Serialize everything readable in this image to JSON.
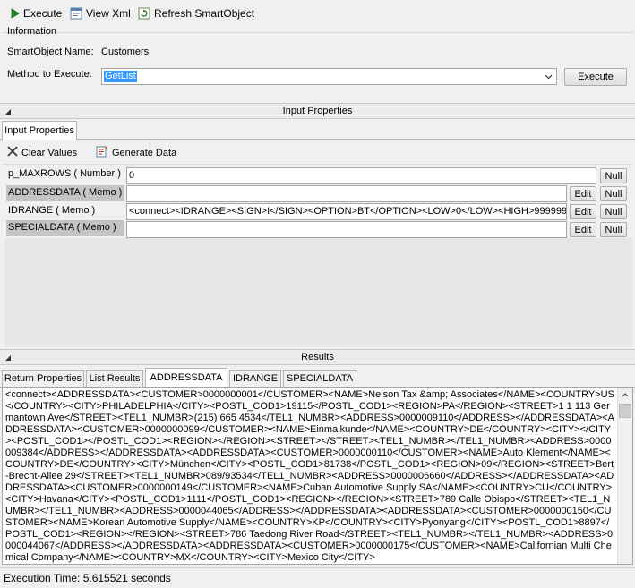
{
  "toolbar": {
    "execute_label": "Execute",
    "view_xml_label": "View Xml",
    "refresh_label": "Refresh SmartObject"
  },
  "information": {
    "group_title": "Information",
    "smartobject_name_label": "SmartObject Name:",
    "smartobject_name_value": "Customers",
    "method_label": "Method to Execute:",
    "method_value": "GetList",
    "execute_button": "Execute"
  },
  "input_properties": {
    "section_title": "Input Properties",
    "tab_label": "Input Properties",
    "clear_values_label": "Clear Values",
    "generate_data_label": "Generate Data",
    "edit_label": "Edit",
    "null_label": "Null",
    "rows": [
      {
        "label": "p_MAXROWS ( Number )",
        "value": "0"
      },
      {
        "label": "ADDRESSDATA ( Memo )",
        "value": ""
      },
      {
        "label": "IDRANGE ( Memo )",
        "value": "<connect><IDRANGE><SIGN>I</SIGN><OPTION>BT</OPTION><LOW>0</LOW><HIGH>9999999"
      },
      {
        "label": "SPECIALDATA ( Memo )",
        "value": ""
      }
    ]
  },
  "results": {
    "section_title": "Results",
    "tabs": [
      "Return Properties",
      "List Results",
      "ADDRESSDATA",
      "IDRANGE",
      "SPECIALDATA"
    ],
    "active_tab": "ADDRESSDATA",
    "text": "<connect><ADDRESSDATA><CUSTOMER>0000000001</CUSTOMER><NAME>Nelson Tax &amp; Associates</NAME><COUNTRY>US</COUNTRY><CITY>PHILADELPHIA</CITY><POSTL_COD1>19115</POSTL_COD1><REGION>PA</REGION><STREET>1 1 113 Germantown Ave</STREET><TEL1_NUMBR>(215) 665 4534</TEL1_NUMBR><ADDRESS>0000009110</ADDRESS></ADDRESSDATA><ADDRESSDATA><CUSTOMER>0000000099</CUSTOMER><NAME>Einmalkunde</NAME><COUNTRY>DE</COUNTRY><CITY></CITY><POSTL_COD1></POSTL_COD1><REGION></REGION><STREET></STREET><TEL1_NUMBR></TEL1_NUMBR><ADDRESS>0000009384</ADDRESS></ADDRESSDATA><ADDRESSDATA><CUSTOMER>0000000110</CUSTOMER><NAME>Auto Klement</NAME><COUNTRY>DE</COUNTRY><CITY>München</CITY><POSTL_COD1>81738</POSTL_COD1><REGION>09</REGION><STREET>Bert-Brecht-Allee 29</STREET><TEL1_NUMBR>089/93534</TEL1_NUMBR><ADDRESS>0000006660</ADDRESS></ADDRESSDATA><ADDRESSDATA><CUSTOMER>0000000149</CUSTOMER><NAME>Cuban Automotive Supply SA</NAME><COUNTRY>CU</COUNTRY><CITY>Havana</CITY><POSTL_COD1>1111</POSTL_COD1><REGION></REGION><STREET>789 Calle Obispo</STREET><TEL1_NUMBR></TEL1_NUMBR><ADDRESS>0000044065</ADDRESS></ADDRESSDATA><ADDRESSDATA><CUSTOMER>0000000150</CUSTOMER><NAME>Korean Automotive Supply</NAME><COUNTRY>KP</COUNTRY><CITY>Pyonyang</CITY><POSTL_COD1>8897</POSTL_COD1><REGION></REGION><STREET>786 Taedong River Road</STREET><TEL1_NUMBR></TEL1_NUMBR><ADDRESS>0000044067</ADDRESS></ADDRESSDATA><ADDRESSDATA><CUSTOMER>0000000175</CUSTOMER><NAME>Californian Multi Chemical Company</NAME><COUNTRY>MX</COUNTRY><CITY>Mexico City</CITY>"
  },
  "status": {
    "execution_time": "Execution Time: 5.615521 seconds"
  }
}
